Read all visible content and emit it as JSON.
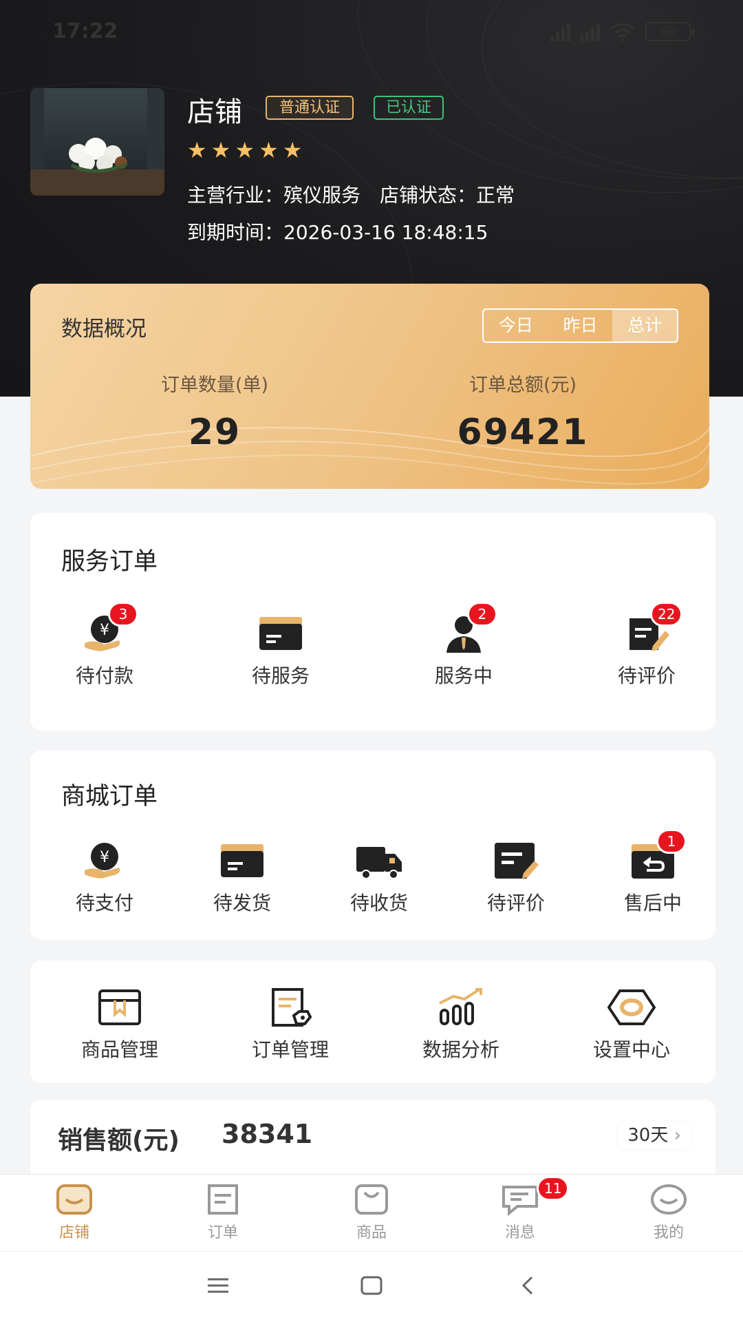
{
  "status_bar": {
    "time": "17:22",
    "battery": "60"
  },
  "shop": {
    "name": "店铺",
    "tags": [
      "普通认证",
      "已认证"
    ],
    "rating_stars": 5,
    "industry_label": "主营行业：",
    "industry": "殡仪服务",
    "status_label": "店铺状态：",
    "status": "正常",
    "expiry_label": "到期时间：",
    "expiry": "2026-03-16 18:48:15"
  },
  "overview": {
    "title": "数据概况",
    "periods": [
      "今日",
      "昨日",
      "总计"
    ],
    "active_period": "总计",
    "order_count_label": "订单数量(单)",
    "order_count": "29",
    "order_total_label": "订单总额(元)",
    "order_total": "69421"
  },
  "service_orders": {
    "title": "服务订单",
    "items": [
      {
        "label": "待付款",
        "icon": "payment-icon",
        "badge": "3"
      },
      {
        "label": "待服务",
        "icon": "box-icon",
        "badge": ""
      },
      {
        "label": "服务中",
        "icon": "person-icon",
        "badge": "2"
      },
      {
        "label": "待评价",
        "icon": "review-icon",
        "badge": "22"
      }
    ]
  },
  "mall_orders": {
    "title": "商城订单",
    "items": [
      {
        "label": "待支付",
        "icon": "payment-icon",
        "badge": ""
      },
      {
        "label": "待发货",
        "icon": "box-icon",
        "badge": ""
      },
      {
        "label": "待收货",
        "icon": "truck-icon",
        "badge": ""
      },
      {
        "label": "待评价",
        "icon": "review-icon",
        "badge": ""
      },
      {
        "label": "售后中",
        "icon": "return-icon",
        "badge": "1"
      }
    ]
  },
  "tools": {
    "items": [
      {
        "label": "商品管理",
        "icon": "product-box-icon"
      },
      {
        "label": "订单管理",
        "icon": "order-doc-icon"
      },
      {
        "label": "数据分析",
        "icon": "chart-icon"
      },
      {
        "label": "设置中心",
        "icon": "settings-hex-icon"
      }
    ]
  },
  "sales": {
    "label": "销售额(元)",
    "value": "38341",
    "range": "30天"
  },
  "tabbar": {
    "items": [
      {
        "label": "店铺",
        "icon": "shop-icon",
        "active": true
      },
      {
        "label": "订单",
        "icon": "order-icon"
      },
      {
        "label": "商品",
        "icon": "bag-icon"
      },
      {
        "label": "消息",
        "icon": "message-icon",
        "badge": "11"
      },
      {
        "label": "我的",
        "icon": "smile-icon"
      }
    ]
  },
  "colors": {
    "accent": "#c8914a",
    "badge": "#e8151f",
    "dark": "#1a1a1c",
    "gold": "#f2c27a"
  }
}
